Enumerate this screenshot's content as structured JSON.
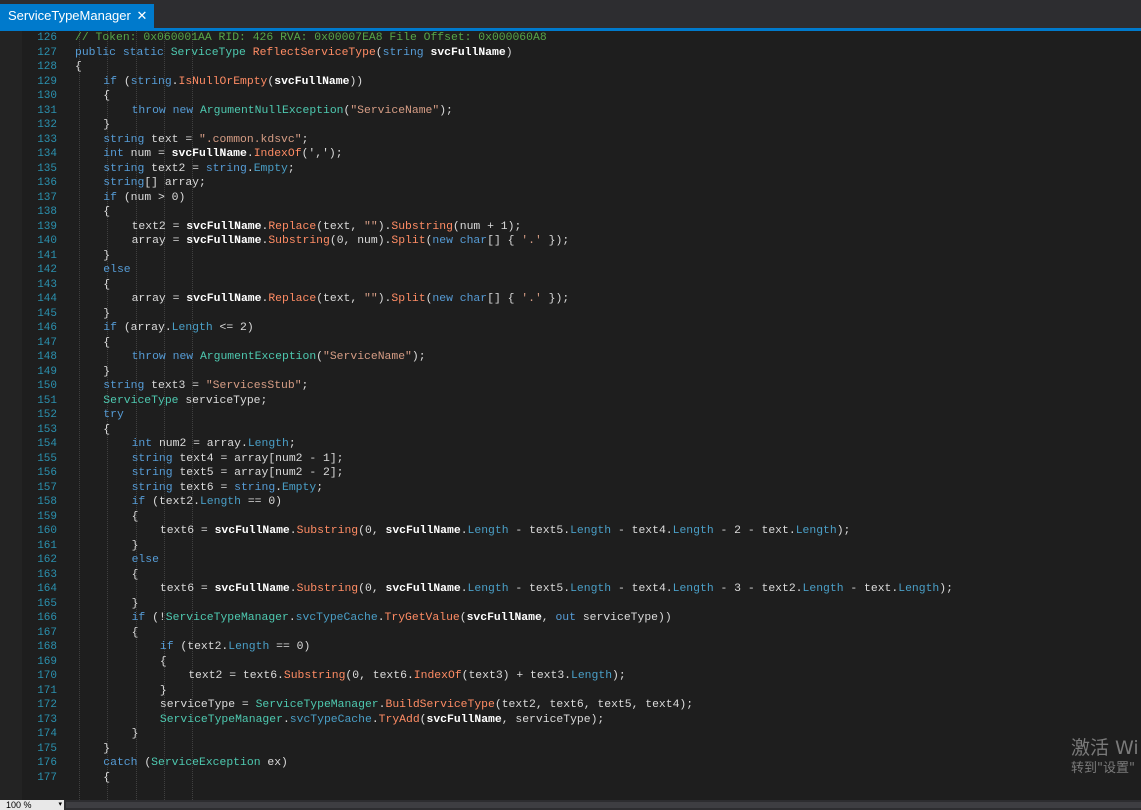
{
  "tab": {
    "title": "ServiceTypeManager",
    "close_glyph": "✕"
  },
  "status": {
    "zoom": "100 %"
  },
  "watermark": {
    "line1": "激活 Wi",
    "line2": "转到\"设置\""
  },
  "colors": {
    "accent": "#007acc",
    "background": "#1e1e1e",
    "keyword": "#569cd6",
    "type": "#4ec9b0",
    "method": "#ff8c64",
    "string": "#d69d85",
    "comment": "#57a64a",
    "line_number": "#2b91af"
  },
  "lines": [
    {
      "n": "126",
      "lvl": 1,
      "t": [
        [
          "// Token: 0x060001AA RID: 426 RVA: 0x00007EA8 File Offset: 0x000060A8",
          "cm"
        ]
      ]
    },
    {
      "n": "127",
      "lvl": 1,
      "t": [
        [
          "public static ",
          "kw"
        ],
        [
          "ServiceType ",
          "ty"
        ],
        [
          "ReflectServiceType",
          "fn"
        ],
        [
          "(",
          ""
        ],
        [
          "string ",
          "kw"
        ],
        [
          "svcFullName",
          "bold"
        ],
        [
          ")",
          ""
        ]
      ]
    },
    {
      "n": "128",
      "lvl": 1,
      "t": [
        [
          "{",
          ""
        ]
      ]
    },
    {
      "n": "129",
      "lvl": 2,
      "t": [
        [
          "if ",
          "kw"
        ],
        [
          "(",
          ""
        ],
        [
          "string",
          "kw"
        ],
        [
          ".",
          ""
        ],
        [
          "IsNullOrEmpty",
          "fn"
        ],
        [
          "(",
          ""
        ],
        [
          "svcFullName",
          "bold"
        ],
        [
          "))",
          ""
        ]
      ]
    },
    {
      "n": "130",
      "lvl": 2,
      "t": [
        [
          "{",
          ""
        ]
      ]
    },
    {
      "n": "131",
      "lvl": 3,
      "t": [
        [
          "throw new ",
          "kw"
        ],
        [
          "ArgumentNullException",
          "ty"
        ],
        [
          "(",
          ""
        ],
        [
          "\"ServiceName\"",
          "str"
        ],
        [
          ");",
          ""
        ]
      ]
    },
    {
      "n": "132",
      "lvl": 2,
      "t": [
        [
          "}",
          ""
        ]
      ]
    },
    {
      "n": "133",
      "lvl": 2,
      "t": [
        [
          "string ",
          "kw"
        ],
        [
          "text = ",
          ""
        ],
        [
          "\".common.kdsvc\"",
          "str"
        ],
        [
          ";",
          ""
        ]
      ]
    },
    {
      "n": "134",
      "lvl": 2,
      "t": [
        [
          "int ",
          "kw"
        ],
        [
          "num = ",
          ""
        ],
        [
          "svcFullName",
          "bold"
        ],
        [
          ".",
          ""
        ],
        [
          "IndexOf",
          "fn"
        ],
        [
          "(',');",
          ""
        ]
      ]
    },
    {
      "n": "135",
      "lvl": 2,
      "t": [
        [
          "string ",
          "kw"
        ],
        [
          "text2 = ",
          ""
        ],
        [
          "string",
          "kw"
        ],
        [
          ".",
          ""
        ],
        [
          "Empty",
          "prop"
        ],
        [
          ";",
          ""
        ]
      ]
    },
    {
      "n": "136",
      "lvl": 2,
      "t": [
        [
          "string",
          "kw"
        ],
        [
          "[] array;",
          ""
        ]
      ]
    },
    {
      "n": "137",
      "lvl": 2,
      "t": [
        [
          "if ",
          "kw"
        ],
        [
          "(num > 0)",
          ""
        ]
      ]
    },
    {
      "n": "138",
      "lvl": 2,
      "t": [
        [
          "{",
          ""
        ]
      ]
    },
    {
      "n": "139",
      "lvl": 3,
      "t": [
        [
          "text2 = ",
          ""
        ],
        [
          "svcFullName",
          "bold"
        ],
        [
          ".",
          ""
        ],
        [
          "Replace",
          "fn"
        ],
        [
          "(text, ",
          ""
        ],
        [
          "\"\"",
          "str"
        ],
        [
          ").",
          ""
        ],
        [
          "Substring",
          "fn"
        ],
        [
          "(num + 1);",
          ""
        ]
      ]
    },
    {
      "n": "140",
      "lvl": 3,
      "t": [
        [
          "array = ",
          ""
        ],
        [
          "svcFullName",
          "bold"
        ],
        [
          ".",
          ""
        ],
        [
          "Substring",
          "fn"
        ],
        [
          "(0, num).",
          ""
        ],
        [
          "Split",
          "fn"
        ],
        [
          "(",
          ""
        ],
        [
          "new char",
          "kw"
        ],
        [
          "[] { ",
          ""
        ],
        [
          "'.'",
          "str"
        ],
        [
          " });",
          ""
        ]
      ]
    },
    {
      "n": "141",
      "lvl": 2,
      "t": [
        [
          "}",
          ""
        ]
      ]
    },
    {
      "n": "142",
      "lvl": 2,
      "t": [
        [
          "else",
          "kw"
        ]
      ]
    },
    {
      "n": "143",
      "lvl": 2,
      "t": [
        [
          "{",
          ""
        ]
      ]
    },
    {
      "n": "144",
      "lvl": 3,
      "t": [
        [
          "array = ",
          ""
        ],
        [
          "svcFullName",
          "bold"
        ],
        [
          ".",
          ""
        ],
        [
          "Replace",
          "fn"
        ],
        [
          "(text, ",
          ""
        ],
        [
          "\"\"",
          "str"
        ],
        [
          ").",
          ""
        ],
        [
          "Split",
          "fn"
        ],
        [
          "(",
          ""
        ],
        [
          "new char",
          "kw"
        ],
        [
          "[] { ",
          ""
        ],
        [
          "'.'",
          "str"
        ],
        [
          " });",
          ""
        ]
      ]
    },
    {
      "n": "145",
      "lvl": 2,
      "t": [
        [
          "}",
          ""
        ]
      ]
    },
    {
      "n": "146",
      "lvl": 2,
      "t": [
        [
          "if ",
          "kw"
        ],
        [
          "(array.",
          ""
        ],
        [
          "Length",
          "prop"
        ],
        [
          " <= 2)",
          ""
        ]
      ]
    },
    {
      "n": "147",
      "lvl": 2,
      "t": [
        [
          "{",
          ""
        ]
      ]
    },
    {
      "n": "148",
      "lvl": 3,
      "t": [
        [
          "throw new ",
          "kw"
        ],
        [
          "ArgumentException",
          "ty"
        ],
        [
          "(",
          ""
        ],
        [
          "\"ServiceName\"",
          "str"
        ],
        [
          ");",
          ""
        ]
      ]
    },
    {
      "n": "149",
      "lvl": 2,
      "t": [
        [
          "}",
          ""
        ]
      ]
    },
    {
      "n": "150",
      "lvl": 2,
      "t": [
        [
          "string ",
          "kw"
        ],
        [
          "text3 = ",
          ""
        ],
        [
          "\"ServicesStub\"",
          "str"
        ],
        [
          ";",
          ""
        ]
      ]
    },
    {
      "n": "151",
      "lvl": 2,
      "t": [
        [
          "ServiceType ",
          "ty"
        ],
        [
          "serviceType;",
          ""
        ]
      ]
    },
    {
      "n": "152",
      "lvl": 2,
      "t": [
        [
          "try",
          "kw"
        ]
      ]
    },
    {
      "n": "153",
      "lvl": 2,
      "t": [
        [
          "{",
          ""
        ]
      ]
    },
    {
      "n": "154",
      "lvl": 3,
      "t": [
        [
          "int ",
          "kw"
        ],
        [
          "num2 = array.",
          ""
        ],
        [
          "Length",
          "prop"
        ],
        [
          ";",
          ""
        ]
      ]
    },
    {
      "n": "155",
      "lvl": 3,
      "t": [
        [
          "string ",
          "kw"
        ],
        [
          "text4 = array[num2 - 1];",
          ""
        ]
      ]
    },
    {
      "n": "156",
      "lvl": 3,
      "t": [
        [
          "string ",
          "kw"
        ],
        [
          "text5 = array[num2 - 2];",
          ""
        ]
      ]
    },
    {
      "n": "157",
      "lvl": 3,
      "t": [
        [
          "string ",
          "kw"
        ],
        [
          "text6 = ",
          ""
        ],
        [
          "string",
          "kw"
        ],
        [
          ".",
          ""
        ],
        [
          "Empty",
          "prop"
        ],
        [
          ";",
          ""
        ]
      ]
    },
    {
      "n": "158",
      "lvl": 3,
      "t": [
        [
          "if ",
          "kw"
        ],
        [
          "(text2.",
          ""
        ],
        [
          "Length",
          "prop"
        ],
        [
          " == 0)",
          ""
        ]
      ]
    },
    {
      "n": "159",
      "lvl": 3,
      "t": [
        [
          "{",
          ""
        ]
      ]
    },
    {
      "n": "160",
      "lvl": 4,
      "t": [
        [
          "text6 = ",
          ""
        ],
        [
          "svcFullName",
          "bold"
        ],
        [
          ".",
          ""
        ],
        [
          "Substring",
          "fn"
        ],
        [
          "(0, ",
          ""
        ],
        [
          "svcFullName",
          "bold"
        ],
        [
          ".",
          ""
        ],
        [
          "Length",
          "prop"
        ],
        [
          " - text5.",
          ""
        ],
        [
          "Length",
          "prop"
        ],
        [
          " - text4.",
          ""
        ],
        [
          "Length",
          "prop"
        ],
        [
          " - 2 - text.",
          ""
        ],
        [
          "Length",
          "prop"
        ],
        [
          ");",
          ""
        ]
      ]
    },
    {
      "n": "161",
      "lvl": 3,
      "t": [
        [
          "}",
          ""
        ]
      ]
    },
    {
      "n": "162",
      "lvl": 3,
      "t": [
        [
          "else",
          "kw"
        ]
      ]
    },
    {
      "n": "163",
      "lvl": 3,
      "t": [
        [
          "{",
          ""
        ]
      ]
    },
    {
      "n": "164",
      "lvl": 4,
      "t": [
        [
          "text6 = ",
          ""
        ],
        [
          "svcFullName",
          "bold"
        ],
        [
          ".",
          ""
        ],
        [
          "Substring",
          "fn"
        ],
        [
          "(0, ",
          ""
        ],
        [
          "svcFullName",
          "bold"
        ],
        [
          ".",
          ""
        ],
        [
          "Length",
          "prop"
        ],
        [
          " - text5.",
          ""
        ],
        [
          "Length",
          "prop"
        ],
        [
          " - text4.",
          ""
        ],
        [
          "Length",
          "prop"
        ],
        [
          " - 3 - text2.",
          ""
        ],
        [
          "Length",
          "prop"
        ],
        [
          " - text.",
          ""
        ],
        [
          "Length",
          "prop"
        ],
        [
          ");",
          ""
        ]
      ]
    },
    {
      "n": "165",
      "lvl": 3,
      "t": [
        [
          "}",
          ""
        ]
      ]
    },
    {
      "n": "166",
      "lvl": 3,
      "t": [
        [
          "if ",
          "kw"
        ],
        [
          "(!",
          ""
        ],
        [
          "ServiceTypeManager",
          "ty"
        ],
        [
          ".",
          ""
        ],
        [
          "svcTypeCache",
          "prop"
        ],
        [
          ".",
          ""
        ],
        [
          "TryGetValue",
          "fn"
        ],
        [
          "(",
          ""
        ],
        [
          "svcFullName",
          "bold"
        ],
        [
          ", ",
          ""
        ],
        [
          "out ",
          "kw"
        ],
        [
          "serviceType))",
          ""
        ]
      ]
    },
    {
      "n": "167",
      "lvl": 3,
      "t": [
        [
          "{",
          ""
        ]
      ]
    },
    {
      "n": "168",
      "lvl": 4,
      "t": [
        [
          "if ",
          "kw"
        ],
        [
          "(text2.",
          ""
        ],
        [
          "Length",
          "prop"
        ],
        [
          " == 0)",
          ""
        ]
      ]
    },
    {
      "n": "169",
      "lvl": 4,
      "t": [
        [
          "{",
          ""
        ]
      ]
    },
    {
      "n": "170",
      "lvl": 5,
      "t": [
        [
          "text2 = text6.",
          ""
        ],
        [
          "Substring",
          "fn"
        ],
        [
          "(0, text6.",
          ""
        ],
        [
          "IndexOf",
          "fn"
        ],
        [
          "(text3) + text3.",
          ""
        ],
        [
          "Length",
          "prop"
        ],
        [
          ");",
          ""
        ]
      ]
    },
    {
      "n": "171",
      "lvl": 4,
      "t": [
        [
          "}",
          ""
        ]
      ]
    },
    {
      "n": "172",
      "lvl": 4,
      "t": [
        [
          "serviceType = ",
          ""
        ],
        [
          "ServiceTypeManager",
          "ty"
        ],
        [
          ".",
          ""
        ],
        [
          "BuildServiceType",
          "fn"
        ],
        [
          "(text2, text6, text5, text4);",
          ""
        ]
      ]
    },
    {
      "n": "173",
      "lvl": 4,
      "t": [
        [
          "ServiceTypeManager",
          "ty"
        ],
        [
          ".",
          ""
        ],
        [
          "svcTypeCache",
          "prop"
        ],
        [
          ".",
          ""
        ],
        [
          "TryAdd",
          "fn"
        ],
        [
          "(",
          ""
        ],
        [
          "svcFullName",
          "bold"
        ],
        [
          ", serviceType);",
          ""
        ]
      ]
    },
    {
      "n": "174",
      "lvl": 3,
      "t": [
        [
          "}",
          ""
        ]
      ]
    },
    {
      "n": "175",
      "lvl": 2,
      "t": [
        [
          "}",
          ""
        ]
      ]
    },
    {
      "n": "176",
      "lvl": 2,
      "t": [
        [
          "catch ",
          "kw"
        ],
        [
          "(",
          ""
        ],
        [
          "ServiceException ",
          "ty"
        ],
        [
          "ex)",
          ""
        ]
      ]
    },
    {
      "n": "177",
      "lvl": 2,
      "t": [
        [
          "{",
          ""
        ]
      ]
    }
  ]
}
